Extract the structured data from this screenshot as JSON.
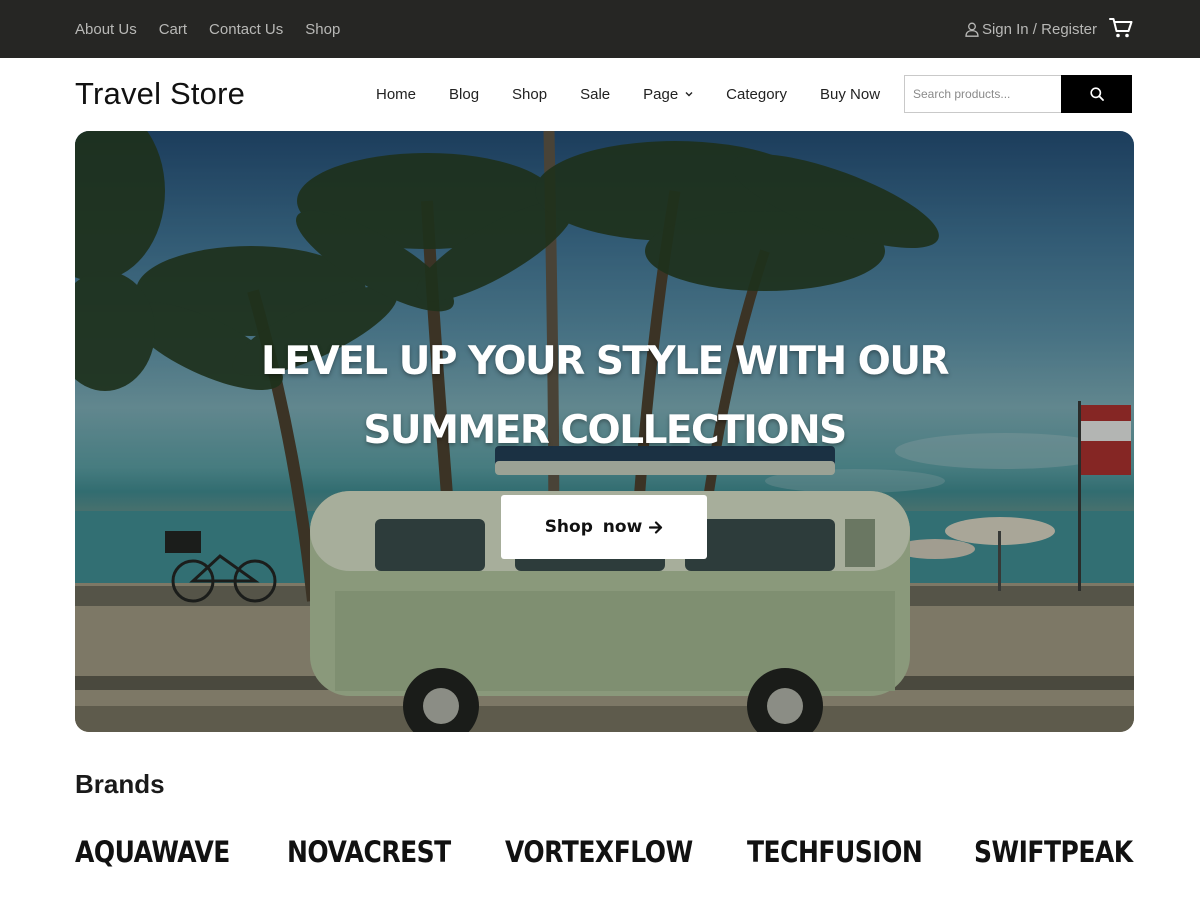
{
  "topbar": {
    "links": [
      "About Us",
      "Cart",
      "Contact Us",
      "Shop"
    ],
    "account_label": "Sign In / Register",
    "cart_icon": "cart-icon",
    "user_icon": "user-icon"
  },
  "header": {
    "logo": "Travel Store",
    "nav": [
      {
        "label": "Home"
      },
      {
        "label": "Blog"
      },
      {
        "label": "Shop"
      },
      {
        "label": "Sale"
      },
      {
        "label": "Page",
        "has_dropdown": true
      },
      {
        "label": "Category"
      },
      {
        "label": "Buy Now"
      }
    ],
    "search": {
      "placeholder": "Search products...",
      "value": "",
      "button_icon": "search-icon"
    }
  },
  "hero": {
    "title_line1": "LEVEL UP YOUR STYLE WITH OUR",
    "title_line2": "SUMMER COLLECTIONS",
    "cta_label": "Shop now",
    "cta_icon": "arrow-right-icon"
  },
  "brands": {
    "heading": "Brands",
    "items": [
      "AQUAWAVE",
      "NOVACREST",
      "VORTEXFLOW",
      "TECHFUSION",
      "SWIFTPEAK"
    ]
  },
  "colors": {
    "topbar_bg": "#262624",
    "topbar_text": "#b8b8b6",
    "accent_button": "#000000",
    "hero_cta_bg": "#ffffff"
  }
}
